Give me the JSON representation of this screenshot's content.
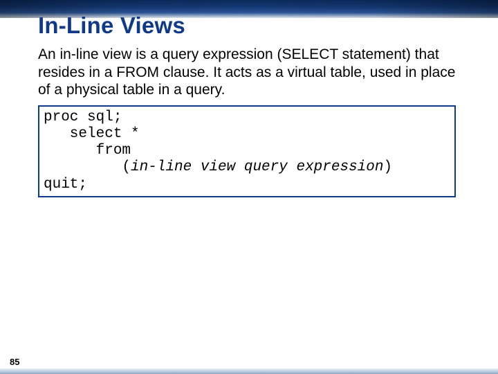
{
  "slide": {
    "title": "In-Line Views",
    "description": "An in-line view is a query expression (SELECT statement) that resides in a FROM clause. It acts as a virtual table, used in place of a physical table in a query.",
    "code": {
      "line1": "proc sql;",
      "line2": "   select *",
      "line3": "      from",
      "line4_prefix": "         (",
      "line4_italic": "in-line view query expression",
      "line4_suffix": ")",
      "line5": "quit;"
    },
    "page_number": "85"
  }
}
